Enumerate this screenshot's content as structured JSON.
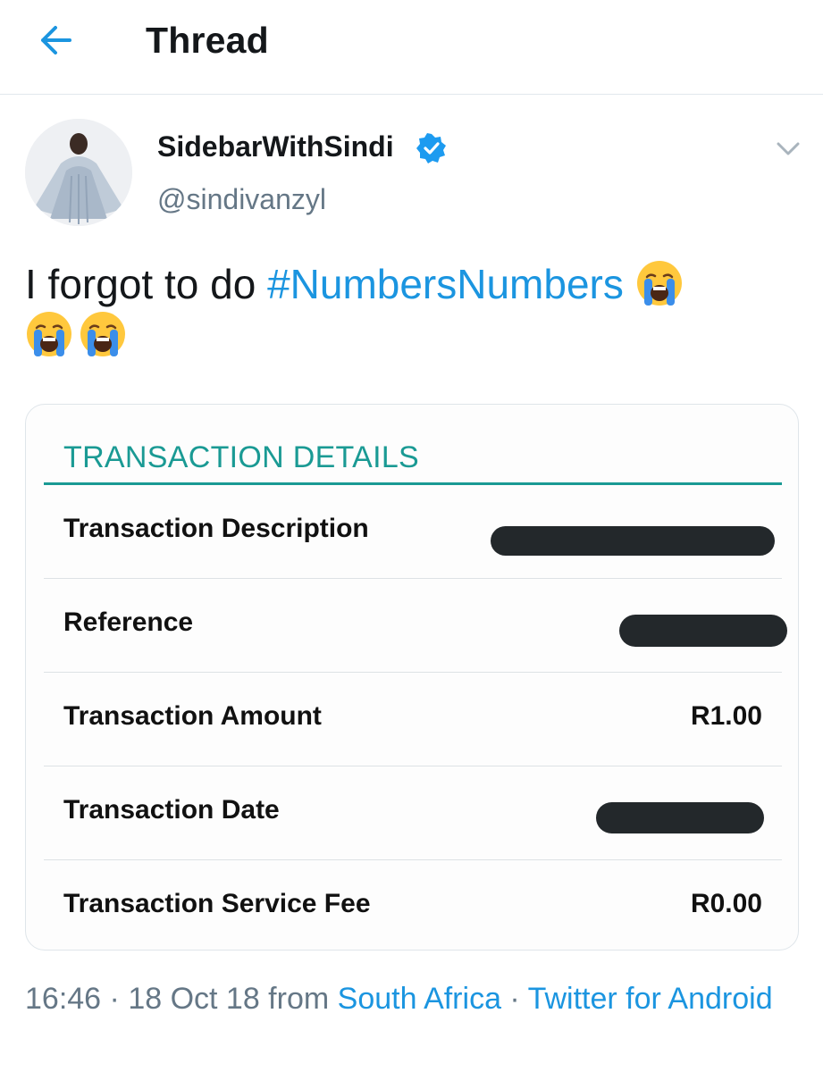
{
  "header": {
    "title": "Thread"
  },
  "author": {
    "display_name": "SidebarWithSindi",
    "handle": "@sindivanzyl",
    "verified": true
  },
  "tweet": {
    "text_before": "I forgot to do ",
    "hashtag": "#NumbersNumbers",
    "emojis": [
      "loudly-crying-face-emoji",
      "loudly-crying-face-emoji",
      "loudly-crying-face-emoji"
    ]
  },
  "card": {
    "title": "TRANSACTION DETAILS",
    "rows": [
      {
        "label": "Transaction Description",
        "value": ""
      },
      {
        "label": "Reference",
        "value": ""
      },
      {
        "label": "Transaction Amount",
        "value": "R1.00"
      },
      {
        "label": "Transaction Date",
        "value": ""
      },
      {
        "label": "Transaction Service Fee",
        "value": "R0.00"
      }
    ]
  },
  "meta": {
    "time": "16:46",
    "sep1": " · ",
    "date": "18 Oct 18",
    "from": " from ",
    "location": "South Africa",
    "sep2": " · ",
    "client": "Twitter for Android"
  },
  "colors": {
    "accent": "#1b95e0",
    "card_accent": "#1a9a94",
    "secondary_text": "#657786"
  }
}
